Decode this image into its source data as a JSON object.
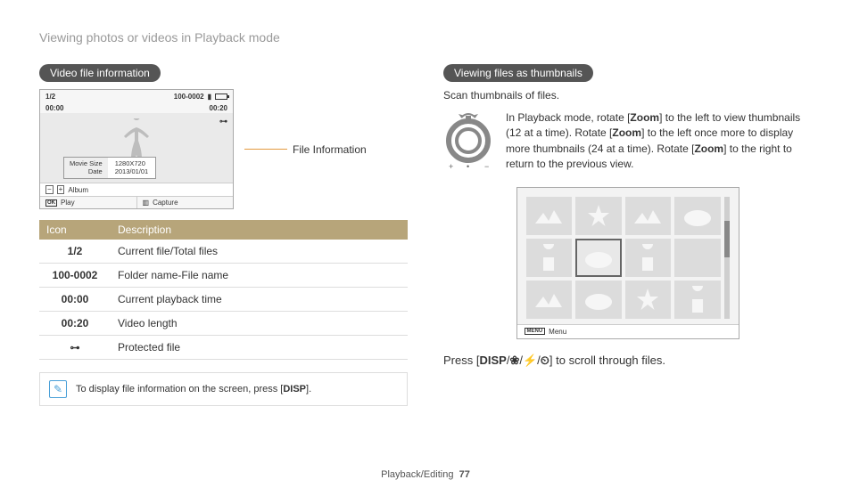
{
  "header": {
    "title": "Viewing photos or videos in Playback mode"
  },
  "left": {
    "pill": "Video file information",
    "figure": {
      "counter": "1/2",
      "folderfile": "100-0002",
      "time_current": "00:00",
      "time_total": "00:20",
      "lock_icon_label": "🔑",
      "info_labels": {
        "l1": "Movie Size",
        "l2": "Date"
      },
      "info_values": {
        "v1": "1280X720",
        "v2": "2013/01/01"
      },
      "album_label": "Album",
      "play_label": "Play",
      "capture_label": "Capture",
      "callout": "File Information"
    },
    "table": {
      "head_icon": "Icon",
      "head_desc": "Description",
      "rows": [
        {
          "icon": "1/2",
          "desc": "Current file/Total files"
        },
        {
          "icon": "100-0002",
          "desc": "Folder name-File name"
        },
        {
          "icon": "00:00",
          "desc": "Current playback time"
        },
        {
          "icon": "00:20",
          "desc": "Video length"
        },
        {
          "icon": "🔑",
          "desc": "Protected file"
        }
      ]
    },
    "note": {
      "pre": "To display file information on the screen, press [",
      "disp": "DISP",
      "post": "]."
    }
  },
  "right": {
    "pill": "Viewing files as thumbnails",
    "subtext": "Scan thumbnails of files.",
    "zoom_text": {
      "p1a": "In Playback mode, rotate [",
      "z": "Zoom",
      "p1b": "] to the left to view thumbnails (12 at a time). Rotate [",
      "p1c": "] to the left once more to display more thumbnails (24 at a time). Rotate [",
      "p1d": "] to the right to return to the previous view."
    },
    "thumb_menu": "Menu",
    "press": {
      "pre": "Press [",
      "disp": "DISP",
      "sep1": "/",
      "macro": "❀",
      "sep2": "/",
      "flash": "⚡",
      "sep3": "/",
      "timer": "⏲",
      "post": "] to scroll through files."
    }
  },
  "footer": {
    "section": "Playback/Editing",
    "page": "77"
  }
}
